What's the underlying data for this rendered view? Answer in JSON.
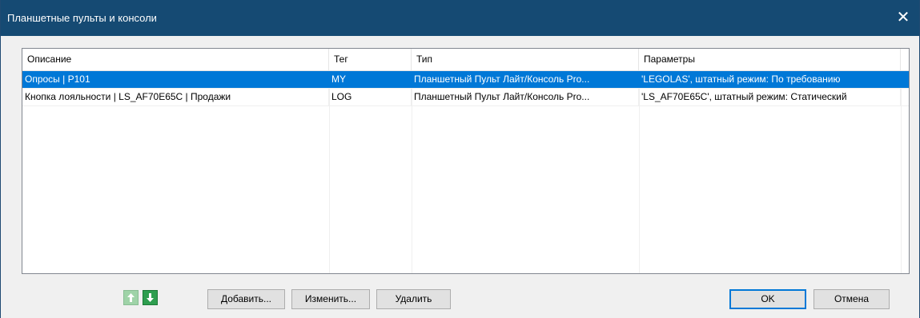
{
  "window": {
    "title": "Планшетные пульты и консоли",
    "close_glyph": "✕"
  },
  "table": {
    "columns": [
      "Описание",
      "Тег",
      "Тип",
      "Параметры"
    ],
    "rows": [
      {
        "description": "Опросы | P101",
        "tag": "MY",
        "type": "Планшетный Пульт Лайт/Консоль Pro...",
        "params": "'LEGOLAS', штатный режим: По требованию",
        "selected": true
      },
      {
        "description": "Кнопка лояльности | LS_AF70E65C | Продажи",
        "tag": "LOG",
        "type": "Планшетный Пульт Лайт/Консоль Pro...",
        "params": "'LS_AF70E65C', штатный режим: Статический",
        "selected": false
      }
    ]
  },
  "buttons": {
    "move_up_icon": "arrow-up-icon",
    "move_down_icon": "arrow-down-icon",
    "add": "Добавить...",
    "edit": "Изменить...",
    "delete": "Удалить",
    "ok": "OK",
    "cancel": "Отмена"
  },
  "colors": {
    "titlebar": "#154a73",
    "selection": "#0078d7",
    "arrow_green": "#2e9e4f"
  }
}
